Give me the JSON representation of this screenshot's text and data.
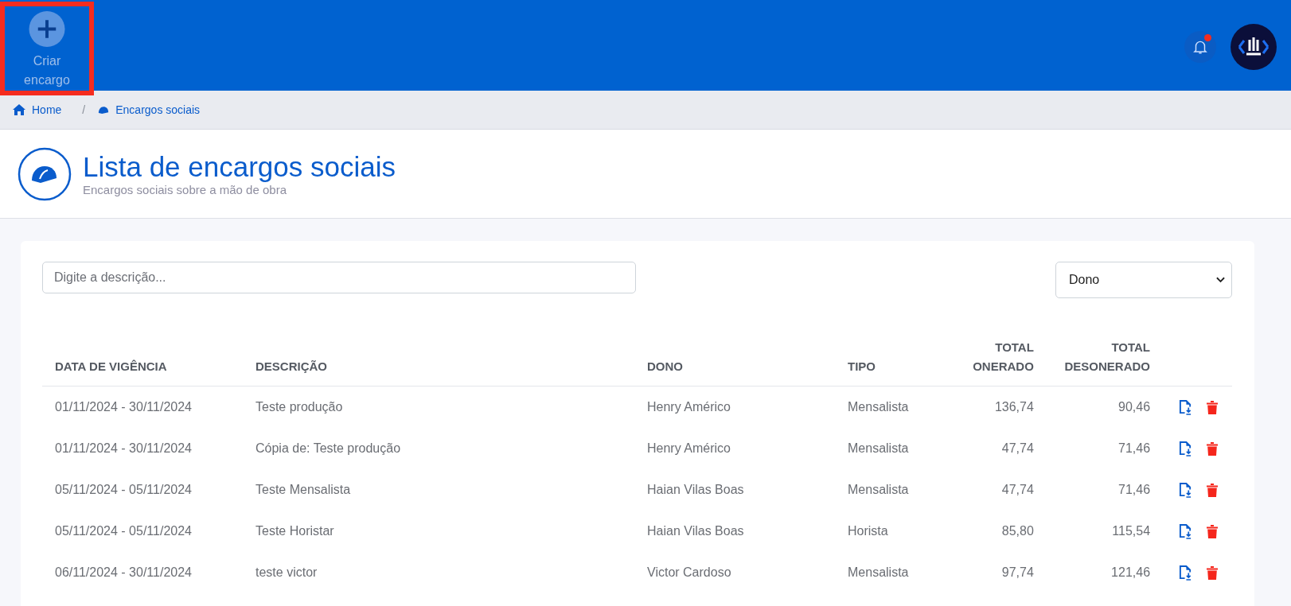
{
  "topbar": {
    "create_button": {
      "label_lines": [
        "Criar",
        "encargo"
      ],
      "highlighted": true
    },
    "notifications": {
      "unread": true
    }
  },
  "breadcrumb_separator": "/",
  "breadcrumb": [
    {
      "label": "Home",
      "kind": "home"
    },
    {
      "label": "Encargos sociais",
      "kind": "helmet"
    }
  ],
  "header": {
    "title": "Lista de encargos sociais",
    "subtitle": "Encargos sociais sobre a mão de obra"
  },
  "filters": {
    "search": {
      "placeholder": "Digite a descrição..."
    },
    "owner_select": {
      "value": "Dono"
    }
  },
  "table": {
    "columns": [
      {
        "label_lines": [
          "DATA DE VIGÊNCIA"
        ],
        "numeric": false
      },
      {
        "label_lines": [
          "DESCRIÇÃO"
        ],
        "numeric": false
      },
      {
        "label_lines": [
          "DONO"
        ],
        "numeric": false
      },
      {
        "label_lines": [
          "TIPO"
        ],
        "numeric": false
      },
      {
        "label_lines": [
          "TOTAL",
          "ONERADO"
        ],
        "numeric": true
      },
      {
        "label_lines": [
          "TOTAL",
          "DESONERADO"
        ],
        "numeric": true
      }
    ],
    "rows": [
      {
        "cells": [
          "01/11/2024 - 30/11/2024",
          "Teste produção",
          "Henry Américo",
          "Mensalista",
          "136,74",
          "90,46"
        ]
      },
      {
        "cells": [
          "01/11/2024 - 30/11/2024",
          "Cópia de: Teste produção",
          "Henry Américo",
          "Mensalista",
          "47,74",
          "71,46"
        ]
      },
      {
        "cells": [
          "05/11/2024 - 05/11/2024",
          "Teste Mensalista",
          "Haian Vilas Boas",
          "Mensalista",
          "47,74",
          "71,46"
        ]
      },
      {
        "cells": [
          "05/11/2024 - 05/11/2024",
          "Teste Horistar",
          "Haian Vilas Boas",
          "Horista",
          "85,80",
          "115,54"
        ]
      },
      {
        "cells": [
          "06/11/2024 - 30/11/2024",
          "teste victor",
          "Victor Cardoso",
          "Mensalista",
          "97,74",
          "121,46"
        ]
      }
    ]
  }
}
